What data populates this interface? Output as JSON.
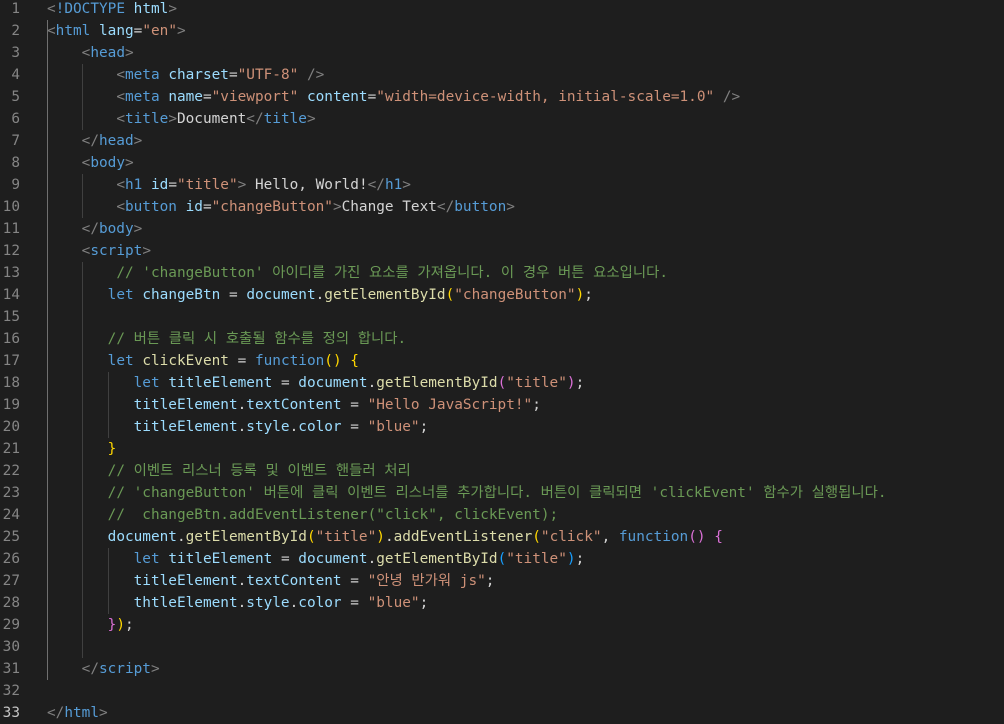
{
  "editor": {
    "colors": {
      "background": "#1e1e1e",
      "line_number": "#858585",
      "tag": "#569cd6",
      "attribute": "#9cdcfe",
      "string": "#ce9178",
      "text": "#d4d4d4",
      "function": "#dcdcaa",
      "comment": "#6a9955",
      "bracket_gold": "#ffd700",
      "bracket_purple": "#da70d6",
      "bracket_blue": "#179fff"
    },
    "active_line": 33,
    "lines": [
      {
        "n": 1,
        "tokens": [
          [
            "punc",
            "<"
          ],
          [
            "tag",
            "!DOCTYPE"
          ],
          [
            "txt",
            " "
          ],
          [
            "attr",
            "html"
          ],
          [
            "punc",
            ">"
          ]
        ]
      },
      {
        "n": 2,
        "tokens": [
          [
            "punc",
            "<"
          ],
          [
            "tag",
            "html"
          ],
          [
            "txt",
            " "
          ],
          [
            "attr",
            "lang"
          ],
          [
            "txt",
            "="
          ],
          [
            "str",
            "\"en\""
          ],
          [
            "punc",
            ">"
          ]
        ]
      },
      {
        "n": 3,
        "tokens": [
          [
            "txt",
            "    "
          ],
          [
            "punc",
            "<"
          ],
          [
            "tag",
            "head"
          ],
          [
            "punc",
            ">"
          ]
        ]
      },
      {
        "n": 4,
        "tokens": [
          [
            "txt",
            "        "
          ],
          [
            "punc",
            "<"
          ],
          [
            "tag",
            "meta"
          ],
          [
            "txt",
            " "
          ],
          [
            "attr",
            "charset"
          ],
          [
            "txt",
            "="
          ],
          [
            "str",
            "\"UTF-8\""
          ],
          [
            "txt",
            " "
          ],
          [
            "punc",
            "/>"
          ]
        ]
      },
      {
        "n": 5,
        "tokens": [
          [
            "txt",
            "        "
          ],
          [
            "punc",
            "<"
          ],
          [
            "tag",
            "meta"
          ],
          [
            "txt",
            " "
          ],
          [
            "attr",
            "name"
          ],
          [
            "txt",
            "="
          ],
          [
            "str",
            "\"viewport\""
          ],
          [
            "txt",
            " "
          ],
          [
            "attr",
            "content"
          ],
          [
            "txt",
            "="
          ],
          [
            "str",
            "\"width=device-width, initial-scale=1.0\""
          ],
          [
            "txt",
            " "
          ],
          [
            "punc",
            "/>"
          ]
        ]
      },
      {
        "n": 6,
        "tokens": [
          [
            "txt",
            "        "
          ],
          [
            "punc",
            "<"
          ],
          [
            "tag",
            "title"
          ],
          [
            "punc",
            ">"
          ],
          [
            "txt",
            "Document"
          ],
          [
            "punc",
            "</"
          ],
          [
            "tag",
            "title"
          ],
          [
            "punc",
            ">"
          ]
        ]
      },
      {
        "n": 7,
        "tokens": [
          [
            "txt",
            "    "
          ],
          [
            "punc",
            "</"
          ],
          [
            "tag",
            "head"
          ],
          [
            "punc",
            ">"
          ]
        ]
      },
      {
        "n": 8,
        "tokens": [
          [
            "txt",
            "    "
          ],
          [
            "punc",
            "<"
          ],
          [
            "tag",
            "body"
          ],
          [
            "punc",
            ">"
          ]
        ]
      },
      {
        "n": 9,
        "tokens": [
          [
            "txt",
            "        "
          ],
          [
            "punc",
            "<"
          ],
          [
            "tag",
            "h1"
          ],
          [
            "txt",
            " "
          ],
          [
            "attr",
            "id"
          ],
          [
            "txt",
            "="
          ],
          [
            "str",
            "\"title\""
          ],
          [
            "punc",
            ">"
          ],
          [
            "txt",
            " Hello, World!"
          ],
          [
            "punc",
            "</"
          ],
          [
            "tag",
            "h1"
          ],
          [
            "punc",
            ">"
          ]
        ]
      },
      {
        "n": 10,
        "tokens": [
          [
            "txt",
            "        "
          ],
          [
            "punc",
            "<"
          ],
          [
            "tag",
            "button"
          ],
          [
            "txt",
            " "
          ],
          [
            "attr",
            "id"
          ],
          [
            "txt",
            "="
          ],
          [
            "str",
            "\"changeButton\""
          ],
          [
            "punc",
            ">"
          ],
          [
            "txt",
            "Change Text"
          ],
          [
            "punc",
            "</"
          ],
          [
            "tag",
            "button"
          ],
          [
            "punc",
            ">"
          ]
        ]
      },
      {
        "n": 11,
        "tokens": [
          [
            "txt",
            "    "
          ],
          [
            "punc",
            "</"
          ],
          [
            "tag",
            "body"
          ],
          [
            "punc",
            ">"
          ]
        ]
      },
      {
        "n": 12,
        "tokens": [
          [
            "txt",
            "    "
          ],
          [
            "punc",
            "<"
          ],
          [
            "tag",
            "script"
          ],
          [
            "punc",
            ">"
          ]
        ]
      },
      {
        "n": 13,
        "tokens": [
          [
            "txt",
            "        "
          ],
          [
            "cmt",
            "// 'changeButton' 아이디를 가진 요소를 가져옵니다. 이 경우 버튼 요소입니다."
          ]
        ]
      },
      {
        "n": 14,
        "tokens": [
          [
            "txt",
            "       "
          ],
          [
            "kw",
            "let"
          ],
          [
            "txt",
            " "
          ],
          [
            "var",
            "changeBtn"
          ],
          [
            "txt",
            " = "
          ],
          [
            "var",
            "document"
          ],
          [
            "txt",
            "."
          ],
          [
            "fn",
            "getElementById"
          ],
          [
            "b1",
            "("
          ],
          [
            "str",
            "\"changeButton\""
          ],
          [
            "b1",
            ")"
          ],
          [
            "txt",
            ";"
          ]
        ]
      },
      {
        "n": 15,
        "tokens": []
      },
      {
        "n": 16,
        "tokens": [
          [
            "txt",
            "       "
          ],
          [
            "cmt",
            "// 버튼 클릭 시 호출될 함수를 정의 합니다."
          ]
        ]
      },
      {
        "n": 17,
        "tokens": [
          [
            "txt",
            "       "
          ],
          [
            "kw",
            "let"
          ],
          [
            "txt",
            " "
          ],
          [
            "fn",
            "clickEvent"
          ],
          [
            "txt",
            " = "
          ],
          [
            "kw",
            "function"
          ],
          [
            "b1",
            "()"
          ],
          [
            "txt",
            " "
          ],
          [
            "b1",
            "{"
          ]
        ]
      },
      {
        "n": 18,
        "tokens": [
          [
            "txt",
            "          "
          ],
          [
            "kw",
            "let"
          ],
          [
            "txt",
            " "
          ],
          [
            "var",
            "titleElement"
          ],
          [
            "txt",
            " = "
          ],
          [
            "var",
            "document"
          ],
          [
            "txt",
            "."
          ],
          [
            "fn",
            "getElementById"
          ],
          [
            "b2",
            "("
          ],
          [
            "str",
            "\"title\""
          ],
          [
            "b2",
            ")"
          ],
          [
            "txt",
            ";"
          ]
        ]
      },
      {
        "n": 19,
        "tokens": [
          [
            "txt",
            "          "
          ],
          [
            "var",
            "titleElement"
          ],
          [
            "txt",
            "."
          ],
          [
            "var",
            "textContent"
          ],
          [
            "txt",
            " = "
          ],
          [
            "str",
            "\"Hello JavaScript!\""
          ],
          [
            "txt",
            ";"
          ]
        ]
      },
      {
        "n": 20,
        "tokens": [
          [
            "txt",
            "          "
          ],
          [
            "var",
            "titleElement"
          ],
          [
            "txt",
            "."
          ],
          [
            "var",
            "style"
          ],
          [
            "txt",
            "."
          ],
          [
            "var",
            "color"
          ],
          [
            "txt",
            " = "
          ],
          [
            "str",
            "\"blue\""
          ],
          [
            "txt",
            ";"
          ]
        ]
      },
      {
        "n": 21,
        "tokens": [
          [
            "txt",
            "       "
          ],
          [
            "b1",
            "}"
          ]
        ]
      },
      {
        "n": 22,
        "tokens": [
          [
            "txt",
            "       "
          ],
          [
            "cmt",
            "// 이벤트 리스너 등록 및 이벤트 핸들러 처리"
          ]
        ]
      },
      {
        "n": 23,
        "tokens": [
          [
            "txt",
            "       "
          ],
          [
            "cmt",
            "// 'changeButton' 버튼에 클릭 이벤트 리스너를 추가합니다. 버튼이 클릭되면 'clickEvent' 함수가 실행됩니다."
          ]
        ]
      },
      {
        "n": 24,
        "tokens": [
          [
            "txt",
            "       "
          ],
          [
            "cmt",
            "//  changeBtn.addEventListener(\"click\", clickEvent);"
          ]
        ]
      },
      {
        "n": 25,
        "tokens": [
          [
            "txt",
            "       "
          ],
          [
            "var",
            "document"
          ],
          [
            "txt",
            "."
          ],
          [
            "fn",
            "getElementById"
          ],
          [
            "b1",
            "("
          ],
          [
            "str",
            "\"title\""
          ],
          [
            "b1",
            ")"
          ],
          [
            "txt",
            "."
          ],
          [
            "fn",
            "addEventListener"
          ],
          [
            "b1",
            "("
          ],
          [
            "str",
            "\"click\""
          ],
          [
            "txt",
            ", "
          ],
          [
            "kw",
            "function"
          ],
          [
            "b2",
            "()"
          ],
          [
            "txt",
            " "
          ],
          [
            "b2",
            "{"
          ]
        ]
      },
      {
        "n": 26,
        "tokens": [
          [
            "txt",
            "          "
          ],
          [
            "kw",
            "let"
          ],
          [
            "txt",
            " "
          ],
          [
            "var",
            "titleElement"
          ],
          [
            "txt",
            " = "
          ],
          [
            "var",
            "document"
          ],
          [
            "txt",
            "."
          ],
          [
            "fn",
            "getElementById"
          ],
          [
            "b3",
            "("
          ],
          [
            "str",
            "\"title\""
          ],
          [
            "b3",
            ")"
          ],
          [
            "txt",
            ";"
          ]
        ]
      },
      {
        "n": 27,
        "tokens": [
          [
            "txt",
            "          "
          ],
          [
            "var",
            "titleElement"
          ],
          [
            "txt",
            "."
          ],
          [
            "var",
            "textContent"
          ],
          [
            "txt",
            " = "
          ],
          [
            "str",
            "\"안녕 반가워 js\""
          ],
          [
            "txt",
            ";"
          ]
        ]
      },
      {
        "n": 28,
        "tokens": [
          [
            "txt",
            "          "
          ],
          [
            "var",
            "thtleElement"
          ],
          [
            "txt",
            "."
          ],
          [
            "var",
            "style"
          ],
          [
            "txt",
            "."
          ],
          [
            "var",
            "color"
          ],
          [
            "txt",
            " = "
          ],
          [
            "str",
            "\"blue\""
          ],
          [
            "txt",
            ";"
          ]
        ]
      },
      {
        "n": 29,
        "tokens": [
          [
            "txt",
            "       "
          ],
          [
            "b2",
            "}"
          ],
          [
            "b1",
            ")"
          ],
          [
            "txt",
            ";"
          ]
        ]
      },
      {
        "n": 30,
        "tokens": []
      },
      {
        "n": 31,
        "tokens": [
          [
            "txt",
            "    "
          ],
          [
            "punc",
            "</"
          ],
          [
            "tag",
            "script"
          ],
          [
            "punc",
            ">"
          ]
        ]
      },
      {
        "n": 32,
        "tokens": []
      },
      {
        "n": 33,
        "tokens": [
          [
            "punc",
            "</"
          ],
          [
            "tag",
            "html"
          ],
          [
            "punc",
            ">"
          ]
        ]
      }
    ]
  }
}
